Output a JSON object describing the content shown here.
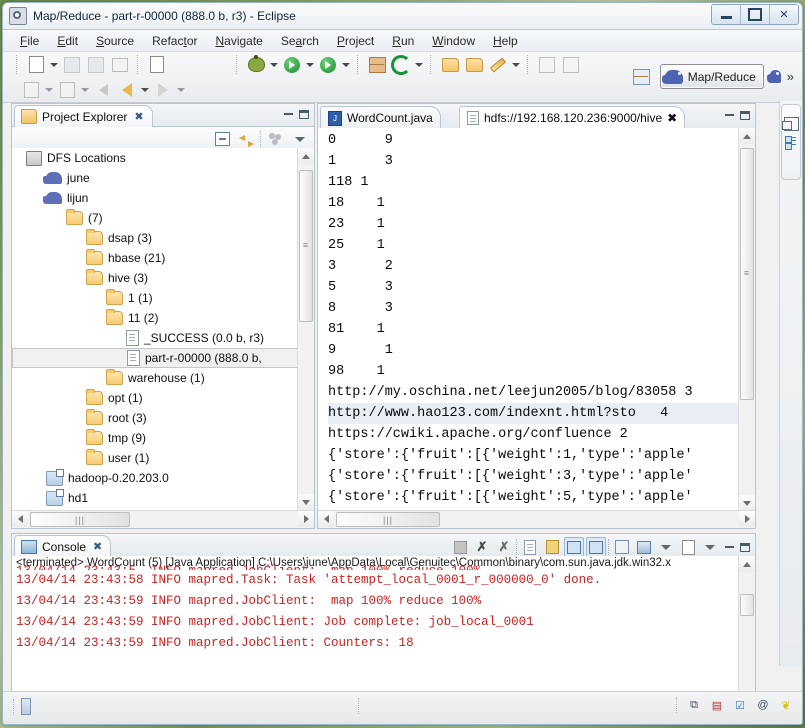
{
  "window": {
    "title": "Map/Reduce - part-r-00000 (888.0 b, r3) - Eclipse",
    "icon": "eclipse-icon",
    "minimize": "–",
    "maximize": "□",
    "close": "✕"
  },
  "menu": [
    {
      "label": "File",
      "mnemonic": "F"
    },
    {
      "label": "Edit",
      "mnemonic": "E"
    },
    {
      "label": "Source",
      "mnemonic": "S"
    },
    {
      "label": "Refactor",
      "mnemonic": "t"
    },
    {
      "label": "Navigate",
      "mnemonic": "N"
    },
    {
      "label": "Search",
      "mnemonic": "a"
    },
    {
      "label": "Project",
      "mnemonic": "P"
    },
    {
      "label": "Run",
      "mnemonic": "R"
    },
    {
      "label": "Window",
      "mnemonic": "W"
    },
    {
      "label": "Help",
      "mnemonic": "H"
    }
  ],
  "toolbar": {
    "row1": [
      {
        "name": "new-wizard-button",
        "icon": "new-document-icon"
      },
      {
        "name": "save-button",
        "icon": "save-icon"
      },
      {
        "name": "save-all-button",
        "icon": "save-all-icon"
      },
      {
        "name": "print-button",
        "icon": "print-icon"
      },
      {
        "name": "toggle-mark-occurrences-button",
        "icon": "binary-doc-icon"
      },
      {
        "name": "debug-button",
        "icon": "bug-icon"
      },
      {
        "name": "run-button",
        "icon": "run-icon"
      },
      {
        "name": "run-external-tools-button",
        "icon": "external-tools-icon"
      },
      {
        "name": "new-java-class-button",
        "icon": "new-class-icon"
      },
      {
        "name": "new-java-package-button",
        "icon": "new-package-icon"
      },
      {
        "name": "open-type-button",
        "icon": "open-type-icon"
      },
      {
        "name": "open-task-button",
        "icon": "open-folder-icon"
      },
      {
        "name": "last-edit-location-button",
        "icon": "pencil-icon"
      },
      {
        "name": "show-whitespace-button",
        "icon": "whitespace-icon"
      },
      {
        "name": "pilcrow-button",
        "icon": "pilcrow-icon"
      }
    ],
    "row2": [
      {
        "name": "import-button",
        "icon": "import-icon"
      },
      {
        "name": "export-button",
        "icon": "export-icon"
      },
      {
        "name": "back-button",
        "icon": "back-arrow-icon"
      },
      {
        "name": "previous-edit-button",
        "icon": "left-arrow-icon"
      },
      {
        "name": "forward-button",
        "icon": "right-arrow-icon"
      }
    ],
    "perspective": {
      "open_perspective_name": "open-perspective-button",
      "active_label": "Map/Reduce",
      "active_icon": "elephant-icon",
      "other_icon": "elephant-icon",
      "overflow": "»"
    }
  },
  "project_explorer": {
    "tab_label": "Project Explorer",
    "tab_icon": "project-explorer-icon",
    "close_glyph": "✖",
    "tools": [
      {
        "name": "collapse-all-button",
        "icon": "collapse-all-icon"
      },
      {
        "name": "link-with-editor-button",
        "icon": "link-editor-icon"
      },
      {
        "name": "focus-on-active-task-button",
        "icon": "focus-task-icon"
      },
      {
        "name": "view-menu-button",
        "icon": "chevron-down-icon"
      }
    ],
    "tree": [
      {
        "label": "DFS Locations",
        "icon": "dfs-locations-icon",
        "indent": 0,
        "selected": false
      },
      {
        "label": "june",
        "icon": "hadoop-elephant-icon",
        "indent": 1,
        "selected": false
      },
      {
        "label": "lijun",
        "icon": "hadoop-elephant-icon",
        "indent": 1,
        "selected": false
      },
      {
        "label": "(7)",
        "icon": "folder-icon",
        "indent": 2,
        "selected": false
      },
      {
        "label": "dsap (3)",
        "icon": "folder-icon",
        "indent": 3,
        "selected": false
      },
      {
        "label": "hbase (21)",
        "icon": "folder-icon",
        "indent": 3,
        "selected": false
      },
      {
        "label": "hive (3)",
        "icon": "folder-icon",
        "indent": 3,
        "selected": false
      },
      {
        "label": "1 (1)",
        "icon": "folder-icon",
        "indent": 4,
        "selected": false
      },
      {
        "label": "11 (2)",
        "icon": "folder-icon",
        "indent": 4,
        "selected": false
      },
      {
        "label": "_SUCCESS (0.0 b, r3)",
        "icon": "file-icon",
        "indent": 5,
        "selected": false
      },
      {
        "label": "part-r-00000 (888.0 b,",
        "icon": "file-icon",
        "indent": 5,
        "selected": true
      },
      {
        "label": "warehouse (1)",
        "icon": "folder-icon",
        "indent": 4,
        "selected": false
      },
      {
        "label": "opt (1)",
        "icon": "folder-icon",
        "indent": 3,
        "selected": false
      },
      {
        "label": "root (3)",
        "icon": "folder-icon",
        "indent": 3,
        "selected": false
      },
      {
        "label": "tmp (9)",
        "icon": "folder-icon",
        "indent": 3,
        "selected": false
      },
      {
        "label": "user (1)",
        "icon": "folder-icon",
        "indent": 3,
        "selected": false
      },
      {
        "label": "hadoop-0.20.203.0",
        "icon": "java-project-icon",
        "indent": 1,
        "selected": false
      },
      {
        "label": "hd1",
        "icon": "java-project-icon",
        "indent": 1,
        "selected": false
      }
    ]
  },
  "editor": {
    "tabs": [
      {
        "label": "WordCount.java",
        "icon": "java-file-icon",
        "active": false,
        "closable": false
      },
      {
        "label": "hdfs://192.168.120.236:9000/hive",
        "icon": "text-file-icon",
        "active": true,
        "closable": true,
        "close_glyph": "✖"
      }
    ],
    "panel_tools": [
      {
        "name": "minimize-editor-button",
        "icon": "minimize-icon"
      },
      {
        "name": "maximize-editor-button",
        "icon": "maximize-icon"
      }
    ],
    "lines": [
      {
        "text": "0      9",
        "highlight": false
      },
      {
        "text": "1      3",
        "highlight": false
      },
      {
        "text": "118 1",
        "highlight": false
      },
      {
        "text": "18    1",
        "highlight": false
      },
      {
        "text": "23    1",
        "highlight": false
      },
      {
        "text": "25    1",
        "highlight": false
      },
      {
        "text": "3      2",
        "highlight": false
      },
      {
        "text": "5      3",
        "highlight": false
      },
      {
        "text": "8      3",
        "highlight": false
      },
      {
        "text": "81    1",
        "highlight": false
      },
      {
        "text": "9      1",
        "highlight": false
      },
      {
        "text": "98    1",
        "highlight": false
      },
      {
        "text": "http://my.oschina.net/leejun2005/blog/83058 3",
        "highlight": false
      },
      {
        "text": "http://www.hao123.com/indexnt.html?sto   4",
        "highlight": true
      },
      {
        "text": "https://cwiki.apache.org/confluence 2",
        "highlight": false
      },
      {
        "text": "{'store':{'fruit':[{'weight':1,'type':'apple'",
        "highlight": false
      },
      {
        "text": "{'store':{'fruit':[{'weight':3,'type':'apple'",
        "highlight": false
      },
      {
        "text": "{'store':{'fruit':[{'weight':5,'type':'apple'",
        "highlight": false
      }
    ]
  },
  "console": {
    "tab_label": "Console",
    "tab_icon": "console-icon",
    "close_glyph": "✖",
    "tools": [
      {
        "name": "terminate-button",
        "icon": "stop-square-icon"
      },
      {
        "name": "remove-launch-button",
        "icon": "remove-x-icon"
      },
      {
        "name": "remove-all-terminated-button",
        "icon": "remove-all-x-icon"
      },
      {
        "name": "clear-console-button",
        "icon": "clear-console-icon"
      },
      {
        "name": "scroll-lock-button",
        "icon": "lock-icon"
      },
      {
        "name": "show-console-on-output-button",
        "icon": "show-console-stdout-icon",
        "selected": true
      },
      {
        "name": "show-console-on-error-button",
        "icon": "show-console-stderr-icon",
        "selected": true
      },
      {
        "name": "pin-console-button",
        "icon": "pin-icon"
      },
      {
        "name": "display-selected-console-button",
        "icon": "display-console-icon"
      },
      {
        "name": "display-selected-console-dropdown",
        "icon": "chevron-down-icon"
      },
      {
        "name": "open-console-button",
        "icon": "new-console-icon"
      },
      {
        "name": "open-console-dropdown",
        "icon": "chevron-down-icon"
      },
      {
        "name": "minimize-console-button",
        "icon": "minimize-icon"
      },
      {
        "name": "maximize-console-button",
        "icon": "maximize-icon"
      }
    ],
    "header": "<terminated> WordCount (5) [Java Application] C:\\Users\\june\\AppData\\Local\\Genuitec\\Common\\binary\\com.sun.java.jdk.win32.x",
    "lines": [
      {
        "text": "13/04/14 23:43:58 INFO mapred.Task: Task 'attempt_local_0001_r_000000_0' done."
      },
      {
        "text": "13/04/14 23:43:59 INFO mapred.JobClient:  map 100% reduce 100%"
      },
      {
        "text": "13/04/14 23:43:59 INFO mapred.JobClient: Job complete: job_local_0001"
      },
      {
        "text": "13/04/14 23:43:59 INFO mapred.JobClient: Counters: 18"
      }
    ]
  },
  "fast_view_bar": [
    {
      "name": "restore-view-button",
      "icon": "restore-icon"
    },
    {
      "name": "outline-view-button",
      "icon": "outline-icon"
    }
  ],
  "status_bar": {
    "left_icon": "smart-insert-icon",
    "right_icons": [
      {
        "name": "restore-perspective-icon",
        "glyph": "⧉"
      },
      {
        "name": "heap-status-icon",
        "glyph": "▤"
      },
      {
        "name": "tasks-icon",
        "glyph": "☑"
      },
      {
        "name": "email-icon",
        "glyph": "@"
      },
      {
        "name": "hadoop-elephant-icon",
        "glyph": "❦"
      }
    ]
  },
  "colors": {
    "console_text": "#cc2222",
    "selection": "#e9eef6",
    "frame_border": "#9cb3cc",
    "accent": "#3c7ab5"
  }
}
